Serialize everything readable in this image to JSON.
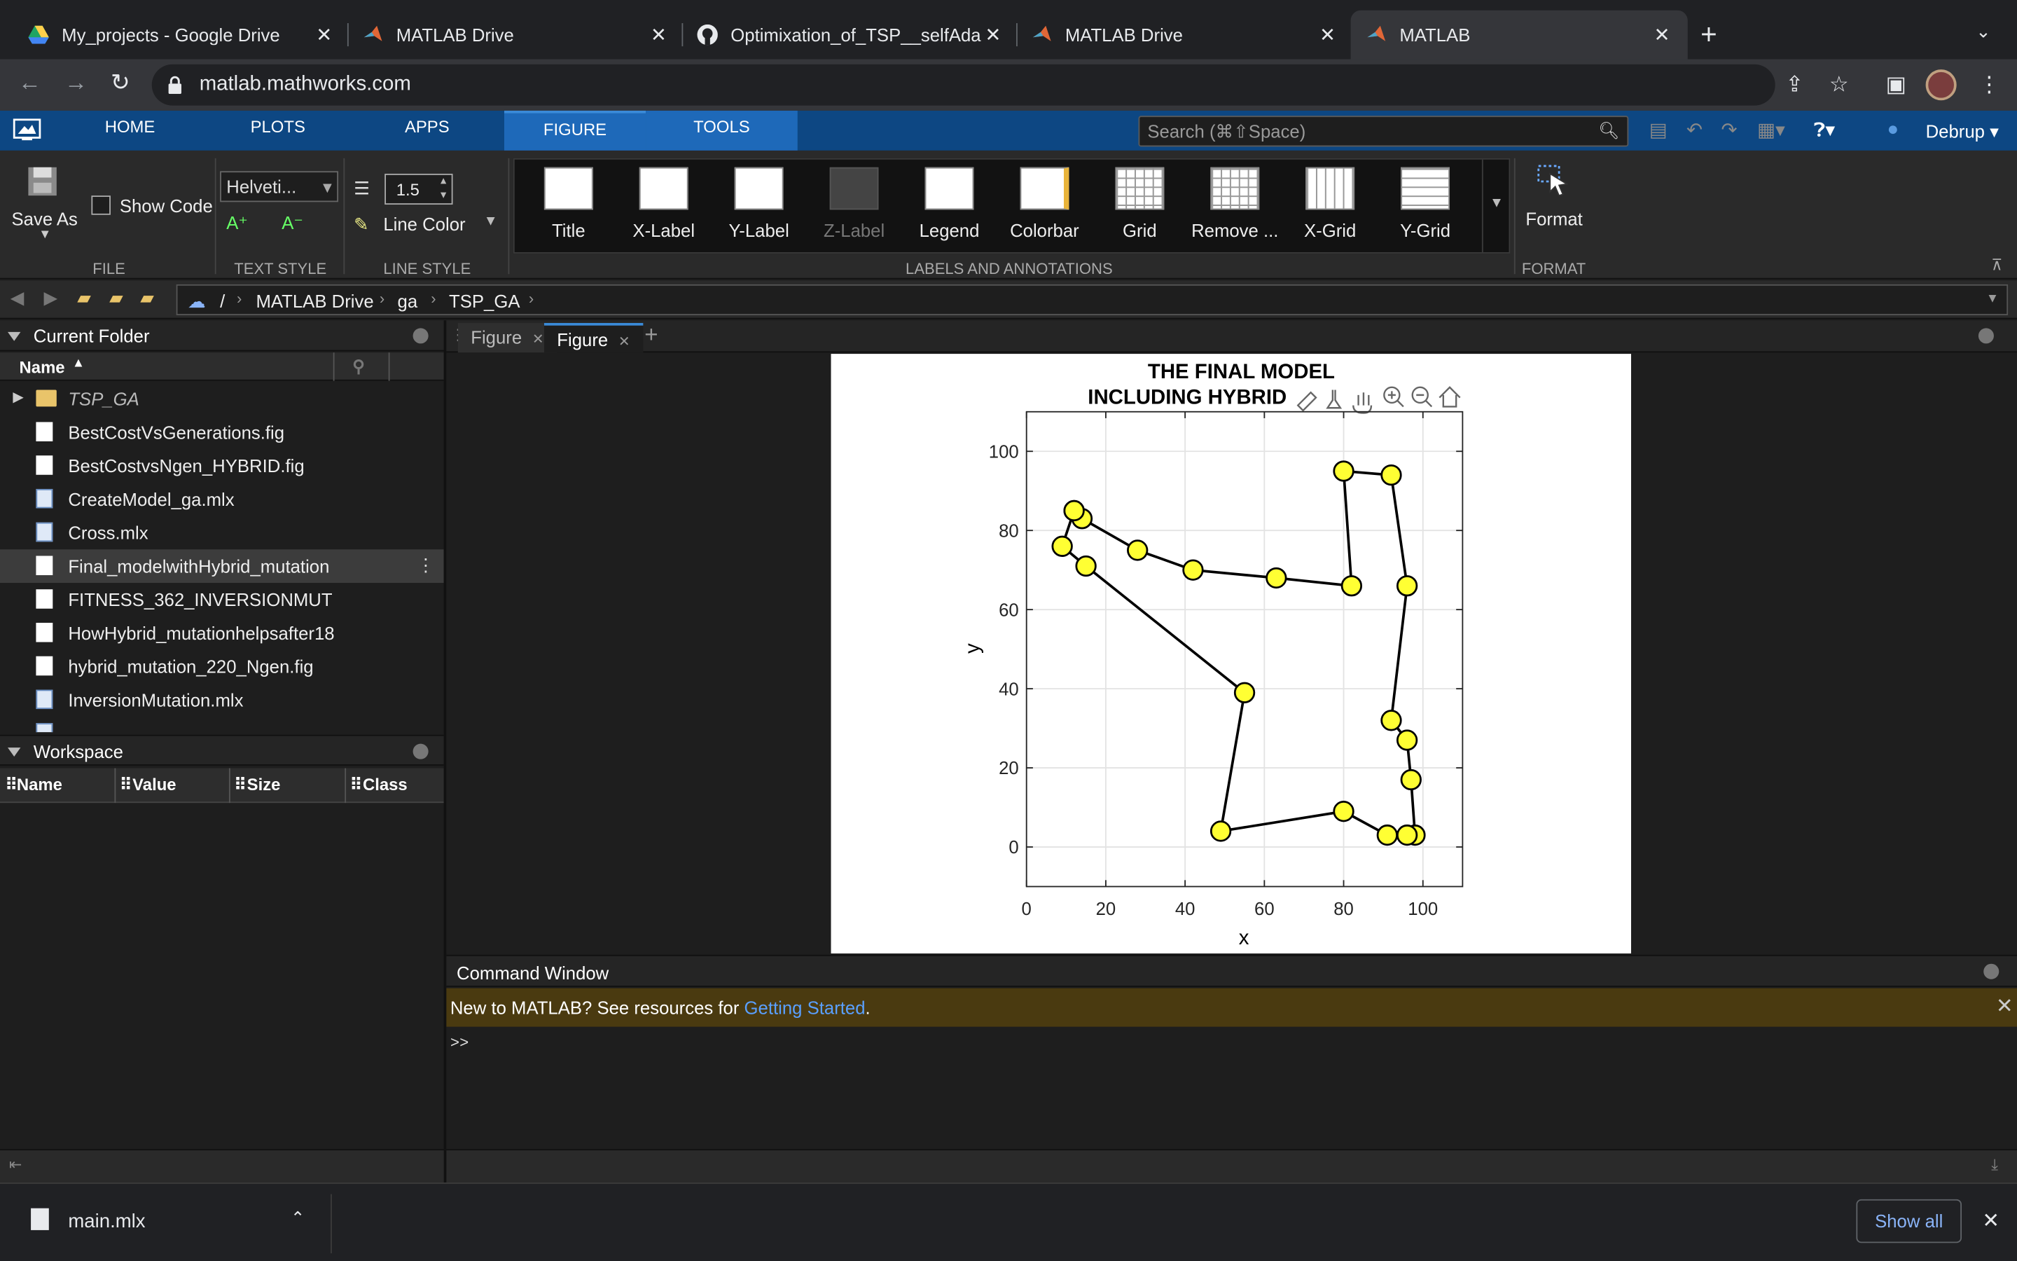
{
  "browser": {
    "tabs": [
      {
        "title": "My_projects - Google Drive"
      },
      {
        "title": "MATLAB Drive"
      },
      {
        "title": "Optimixation_of_TSP__selfAda"
      },
      {
        "title": "MATLAB Drive"
      },
      {
        "title": "MATLAB"
      }
    ],
    "url": "matlab.mathworks.com",
    "download": "main.mlx",
    "show_all": "Show all"
  },
  "toolstrip": {
    "tabs": [
      "HOME",
      "PLOTS",
      "APPS",
      "FIGURE",
      "TOOLS"
    ],
    "search_placeholder": "Search (⌘⇧Space)",
    "user": "Debrup",
    "save_as": "Save As",
    "show_code": "Show Code",
    "font": "Helveti...",
    "line_width": "1.5",
    "line_color": "Line Color",
    "groups": [
      "FILE",
      "TEXT STYLE",
      "LINE STYLE",
      "LABELS AND ANNOTATIONS",
      "FORMAT"
    ],
    "gallery": [
      "Title",
      "X-Label",
      "Y-Label",
      "Z-Label",
      "Legend",
      "Colorbar",
      "Grid",
      "Remove ...",
      "X-Grid",
      "Y-Grid"
    ],
    "format": "Format"
  },
  "address": {
    "root": "/",
    "crumbs": [
      "MATLAB Drive",
      "ga",
      "TSP_GA"
    ]
  },
  "current_folder": {
    "title": "Current Folder",
    "col_name": "Name",
    "items": [
      {
        "name": "TSP_GA",
        "type": "folder"
      },
      {
        "name": "BestCostVsGenerations.fig",
        "type": "fig"
      },
      {
        "name": "BestCostvsNgen_HYBRID.fig",
        "type": "fig"
      },
      {
        "name": "CreateModel_ga.mlx",
        "type": "mlx"
      },
      {
        "name": "Cross.mlx",
        "type": "mlx"
      },
      {
        "name": "Final_modelwithHybrid_mutation",
        "type": "fig"
      },
      {
        "name": "FITNESS_362_INVERSIONMUT",
        "type": "fig"
      },
      {
        "name": "HowHybrid_mutationhelpsafter18",
        "type": "fig"
      },
      {
        "name": "hybrid_mutation_220_Ngen.fig",
        "type": "fig"
      },
      {
        "name": "InversionMutation.mlx",
        "type": "mlx"
      }
    ]
  },
  "workspace": {
    "title": "Workspace",
    "columns": [
      "Name",
      "Value",
      "Size",
      "Class"
    ]
  },
  "figure_tabs": [
    "Figure",
    "Figure"
  ],
  "command_window": {
    "title": "Command Window",
    "banner_prefix": "New to MATLAB? See resources for ",
    "banner_link": "Getting Started",
    "banner_suffix": ".",
    "prompt": ">>"
  },
  "chart_data": {
    "type": "line",
    "title": [
      "THE FINAL MODEL",
      "INCLUDING HYBRID"
    ],
    "xlabel": "x",
    "ylabel": "y",
    "xlim": [
      0,
      110
    ],
    "ylim": [
      -10,
      110
    ],
    "xticks": [
      0,
      20,
      40,
      60,
      80,
      100
    ],
    "yticks": [
      0,
      20,
      40,
      60,
      80,
      100
    ],
    "grid": true,
    "series": [
      {
        "x": [
          12,
          14,
          28,
          42,
          63,
          82,
          80,
          92,
          96,
          92,
          96,
          97,
          98,
          96,
          91,
          80,
          49,
          55,
          15,
          9,
          12
        ],
        "y": [
          85,
          83,
          75,
          70,
          68,
          66,
          95,
          94,
          66,
          32,
          27,
          17,
          3,
          3,
          3,
          9,
          4,
          39,
          71,
          76,
          85
        ],
        "line_color": "#000000",
        "marker_color": "#ffff33"
      }
    ]
  }
}
